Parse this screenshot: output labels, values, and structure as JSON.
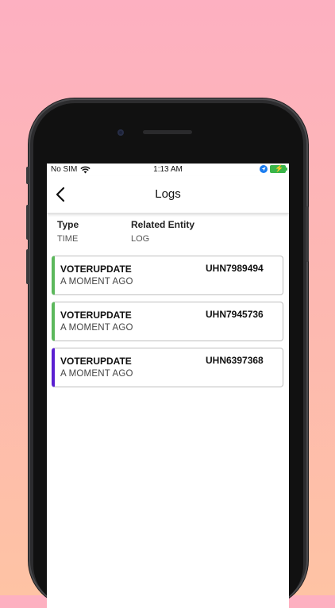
{
  "status_bar": {
    "carrier": "No SIM",
    "time": "1:13 AM"
  },
  "nav": {
    "title": "Logs"
  },
  "header": {
    "col1_label": "Type",
    "col1_sub": "TIME",
    "col2_label": "Related Entity",
    "col2_sub": "LOG"
  },
  "colors": {
    "accent_green": "#5cb85c",
    "accent_purple": "#5a1fd1"
  },
  "logs": [
    {
      "type": "VOTERUPDATE",
      "entity": "UHN7989494",
      "time": "A MOMENT AGO",
      "accent": "#5cb85c"
    },
    {
      "type": "VOTERUPDATE",
      "entity": "UHN7945736",
      "time": "A MOMENT AGO",
      "accent": "#5cb85c"
    },
    {
      "type": "VOTERUPDATE",
      "entity": "UHN6397368",
      "time": "A MOMENT AGO",
      "accent": "#5a1fd1"
    }
  ]
}
